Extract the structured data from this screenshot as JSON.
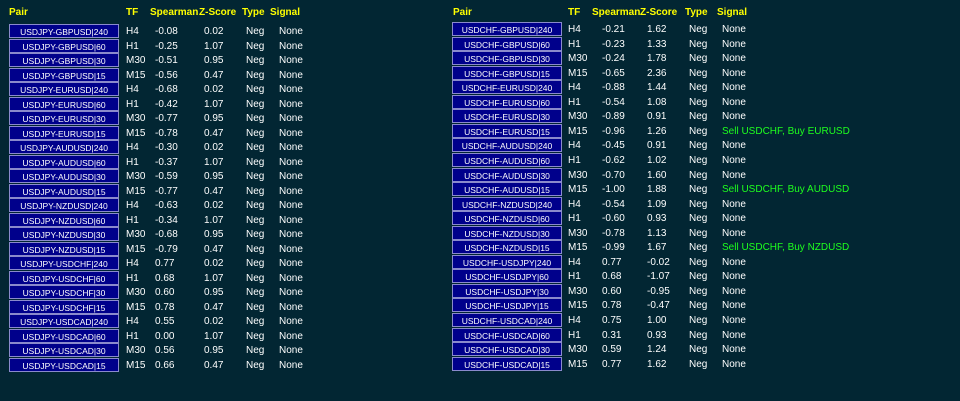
{
  "headers": {
    "pair": "Pair",
    "tf": "TF",
    "spearman": "Spearman",
    "zscore": "Z-Score",
    "type": "Type",
    "signal": "Signal"
  },
  "colors": {
    "background": "#022633",
    "header": "#ffff00",
    "pair_button": "#00008b",
    "signal_active": "#1eff1e",
    "text": "#ffffff"
  },
  "left": [
    {
      "pair": "USDJPY-GBPUSD|240",
      "tf": "H4",
      "spearman": "-0.08",
      "z": "0.02",
      "type": "Neg",
      "signal": "None"
    },
    {
      "pair": "USDJPY-GBPUSD|60",
      "tf": "H1",
      "spearman": "-0.25",
      "z": "1.07",
      "type": "Neg",
      "signal": "None"
    },
    {
      "pair": "USDJPY-GBPUSD|30",
      "tf": "M30",
      "spearman": "-0.51",
      "z": "0.95",
      "type": "Neg",
      "signal": "None"
    },
    {
      "pair": "USDJPY-GBPUSD|15",
      "tf": "M15",
      "spearman": "-0.56",
      "z": "0.47",
      "type": "Neg",
      "signal": "None"
    },
    {
      "pair": "USDJPY-EURUSD|240",
      "tf": "H4",
      "spearman": "-0.68",
      "z": "0.02",
      "type": "Neg",
      "signal": "None"
    },
    {
      "pair": "USDJPY-EURUSD|60",
      "tf": "H1",
      "spearman": "-0.42",
      "z": "1.07",
      "type": "Neg",
      "signal": "None"
    },
    {
      "pair": "USDJPY-EURUSD|30",
      "tf": "M30",
      "spearman": "-0.77",
      "z": "0.95",
      "type": "Neg",
      "signal": "None"
    },
    {
      "pair": "USDJPY-EURUSD|15",
      "tf": "M15",
      "spearman": "-0.78",
      "z": "0.47",
      "type": "Neg",
      "signal": "None"
    },
    {
      "pair": "USDJPY-AUDUSD|240",
      "tf": "H4",
      "spearman": "-0.30",
      "z": "0.02",
      "type": "Neg",
      "signal": "None"
    },
    {
      "pair": "USDJPY-AUDUSD|60",
      "tf": "H1",
      "spearman": "-0.37",
      "z": "1.07",
      "type": "Neg",
      "signal": "None"
    },
    {
      "pair": "USDJPY-AUDUSD|30",
      "tf": "M30",
      "spearman": "-0.59",
      "z": "0.95",
      "type": "Neg",
      "signal": "None"
    },
    {
      "pair": "USDJPY-AUDUSD|15",
      "tf": "M15",
      "spearman": "-0.77",
      "z": "0.47",
      "type": "Neg",
      "signal": "None"
    },
    {
      "pair": "USDJPY-NZDUSD|240",
      "tf": "H4",
      "spearman": "-0.63",
      "z": "0.02",
      "type": "Neg",
      "signal": "None"
    },
    {
      "pair": "USDJPY-NZDUSD|60",
      "tf": "H1",
      "spearman": "-0.34",
      "z": "1.07",
      "type": "Neg",
      "signal": "None"
    },
    {
      "pair": "USDJPY-NZDUSD|30",
      "tf": "M30",
      "spearman": "-0.68",
      "z": "0.95",
      "type": "Neg",
      "signal": "None"
    },
    {
      "pair": "USDJPY-NZDUSD|15",
      "tf": "M15",
      "spearman": "-0.79",
      "z": "0.47",
      "type": "Neg",
      "signal": "None"
    },
    {
      "pair": "USDJPY-USDCHF|240",
      "tf": "H4",
      "spearman": "0.77",
      "z": "0.02",
      "type": "Neg",
      "signal": "None"
    },
    {
      "pair": "USDJPY-USDCHF|60",
      "tf": "H1",
      "spearman": "0.68",
      "z": "1.07",
      "type": "Neg",
      "signal": "None"
    },
    {
      "pair": "USDJPY-USDCHF|30",
      "tf": "M30",
      "spearman": "0.60",
      "z": "0.95",
      "type": "Neg",
      "signal": "None"
    },
    {
      "pair": "USDJPY-USDCHF|15",
      "tf": "M15",
      "spearman": "0.78",
      "z": "0.47",
      "type": "Neg",
      "signal": "None"
    },
    {
      "pair": "USDJPY-USDCAD|240",
      "tf": "H4",
      "spearman": "0.55",
      "z": "0.02",
      "type": "Neg",
      "signal": "None"
    },
    {
      "pair": "USDJPY-USDCAD|60",
      "tf": "H1",
      "spearman": "0.00",
      "z": "1.07",
      "type": "Neg",
      "signal": "None"
    },
    {
      "pair": "USDJPY-USDCAD|30",
      "tf": "M30",
      "spearman": "0.56",
      "z": "0.95",
      "type": "Neg",
      "signal": "None"
    },
    {
      "pair": "USDJPY-USDCAD|15",
      "tf": "M15",
      "spearman": "0.66",
      "z": "0.47",
      "type": "Neg",
      "signal": "None"
    }
  ],
  "right": [
    {
      "pair": "USDCHF-GBPUSD|240",
      "tf": "H4",
      "spearman": "-0.21",
      "z": "1.62",
      "type": "Neg",
      "signal": "None"
    },
    {
      "pair": "USDCHF-GBPUSD|60",
      "tf": "H1",
      "spearman": "-0.23",
      "z": "1.33",
      "type": "Neg",
      "signal": "None"
    },
    {
      "pair": "USDCHF-GBPUSD|30",
      "tf": "M30",
      "spearman": "-0.24",
      "z": "1.78",
      "type": "Neg",
      "signal": "None"
    },
    {
      "pair": "USDCHF-GBPUSD|15",
      "tf": "M15",
      "spearman": "-0.65",
      "z": "2.36",
      "type": "Neg",
      "signal": "None"
    },
    {
      "pair": "USDCHF-EURUSD|240",
      "tf": "H4",
      "spearman": "-0.88",
      "z": "1.44",
      "type": "Neg",
      "signal": "None"
    },
    {
      "pair": "USDCHF-EURUSD|60",
      "tf": "H1",
      "spearman": "-0.54",
      "z": "1.08",
      "type": "Neg",
      "signal": "None"
    },
    {
      "pair": "USDCHF-EURUSD|30",
      "tf": "M30",
      "spearman": "-0.89",
      "z": "0.91",
      "type": "Neg",
      "signal": "None"
    },
    {
      "pair": "USDCHF-EURUSD|15",
      "tf": "M15",
      "spearman": "-0.96",
      "z": "1.26",
      "type": "Neg",
      "signal": "Sell USDCHF, Buy EURUSD"
    },
    {
      "pair": "USDCHF-AUDUSD|240",
      "tf": "H4",
      "spearman": "-0.45",
      "z": "0.91",
      "type": "Neg",
      "signal": "None"
    },
    {
      "pair": "USDCHF-AUDUSD|60",
      "tf": "H1",
      "spearman": "-0.62",
      "z": "1.02",
      "type": "Neg",
      "signal": "None"
    },
    {
      "pair": "USDCHF-AUDUSD|30",
      "tf": "M30",
      "spearman": "-0.70",
      "z": "1.60",
      "type": "Neg",
      "signal": "None"
    },
    {
      "pair": "USDCHF-AUDUSD|15",
      "tf": "M15",
      "spearman": "-1.00",
      "z": "1.88",
      "type": "Neg",
      "signal": "Sell USDCHF, Buy AUDUSD"
    },
    {
      "pair": "USDCHF-NZDUSD|240",
      "tf": "H4",
      "spearman": "-0.54",
      "z": "1.09",
      "type": "Neg",
      "signal": "None"
    },
    {
      "pair": "USDCHF-NZDUSD|60",
      "tf": "H1",
      "spearman": "-0.60",
      "z": "0.93",
      "type": "Neg",
      "signal": "None"
    },
    {
      "pair": "USDCHF-NZDUSD|30",
      "tf": "M30",
      "spearman": "-0.78",
      "z": "1.13",
      "type": "Neg",
      "signal": "None"
    },
    {
      "pair": "USDCHF-NZDUSD|15",
      "tf": "M15",
      "spearman": "-0.99",
      "z": "1.67",
      "type": "Neg",
      "signal": "Sell USDCHF, Buy NZDUSD"
    },
    {
      "pair": "USDCHF-USDJPY|240",
      "tf": "H4",
      "spearman": "0.77",
      "z": "-0.02",
      "type": "Neg",
      "signal": "None"
    },
    {
      "pair": "USDCHF-USDJPY|60",
      "tf": "H1",
      "spearman": "0.68",
      "z": "-1.07",
      "type": "Neg",
      "signal": "None"
    },
    {
      "pair": "USDCHF-USDJPY|30",
      "tf": "M30",
      "spearman": "0.60",
      "z": "-0.95",
      "type": "Neg",
      "signal": "None"
    },
    {
      "pair": "USDCHF-USDJPY|15",
      "tf": "M15",
      "spearman": "0.78",
      "z": "-0.47",
      "type": "Neg",
      "signal": "None"
    },
    {
      "pair": "USDCHF-USDCAD|240",
      "tf": "H4",
      "spearman": "0.75",
      "z": "1.00",
      "type": "Neg",
      "signal": "None"
    },
    {
      "pair": "USDCHF-USDCAD|60",
      "tf": "H1",
      "spearman": "0.31",
      "z": "0.93",
      "type": "Neg",
      "signal": "None"
    },
    {
      "pair": "USDCHF-USDCAD|30",
      "tf": "M30",
      "spearman": "0.59",
      "z": "1.24",
      "type": "Neg",
      "signal": "None"
    },
    {
      "pair": "USDCHF-USDCAD|15",
      "tf": "M15",
      "spearman": "0.77",
      "z": "1.62",
      "type": "Neg",
      "signal": "None"
    }
  ]
}
